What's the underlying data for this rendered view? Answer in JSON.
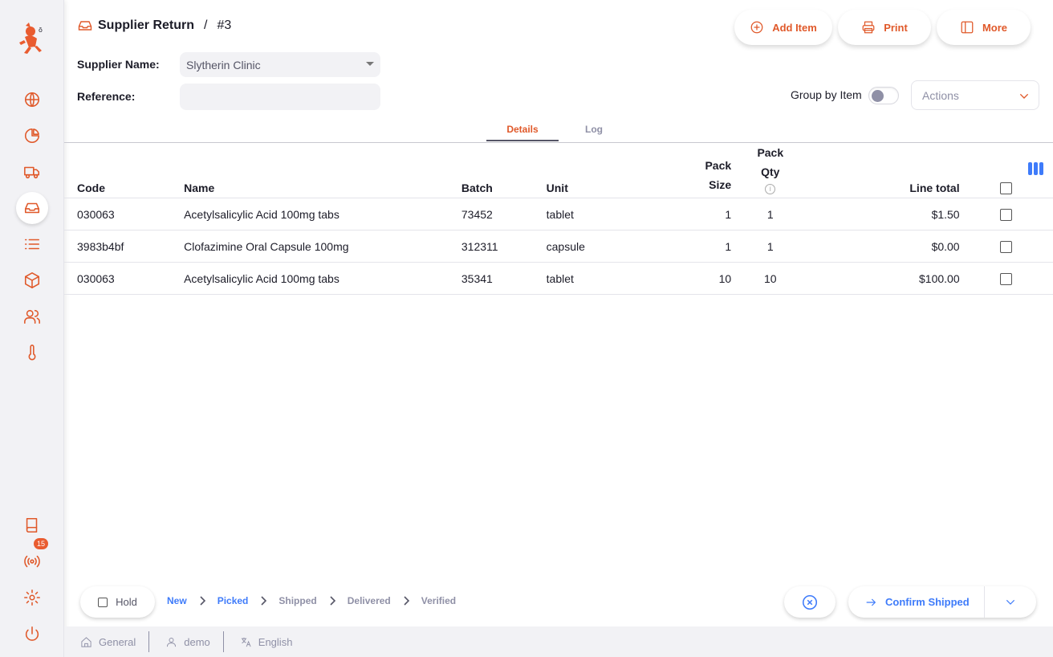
{
  "sidebar": {
    "notification_count": "15",
    "items": [
      {
        "icon": "globe-icon"
      },
      {
        "icon": "pie-chart-icon"
      },
      {
        "icon": "truck-icon"
      },
      {
        "icon": "inbox-icon",
        "active": true
      },
      {
        "icon": "list-icon"
      },
      {
        "icon": "box-icon"
      },
      {
        "icon": "users-icon"
      },
      {
        "icon": "thermometer-icon"
      }
    ],
    "bottom_items": [
      {
        "icon": "book-icon"
      },
      {
        "icon": "broadcast-icon"
      },
      {
        "icon": "gear-icon"
      },
      {
        "icon": "power-icon"
      }
    ]
  },
  "header": {
    "title": "Supplier Return",
    "separator": "/",
    "number": "#3",
    "buttons": {
      "add_item": "Add Item",
      "print": "Print",
      "more": "More"
    }
  },
  "form": {
    "supplier_label": "Supplier Name:",
    "supplier_value": "Slytherin Clinic",
    "reference_label": "Reference:",
    "reference_value": ""
  },
  "controls": {
    "group_by_label": "Group by Item",
    "group_by_enabled": false,
    "actions_placeholder": "Actions"
  },
  "tabs": [
    {
      "label": "Details",
      "active": true
    },
    {
      "label": "Log",
      "active": false
    }
  ],
  "table": {
    "headers": {
      "code": "Code",
      "name": "Name",
      "batch": "Batch",
      "unit": "Unit",
      "pack_size_1": "Pack",
      "pack_size_2": "Size",
      "pack_qty_1": "Pack",
      "pack_qty_2": "Qty",
      "line_total": "Line total",
      "info_glyph": "i"
    },
    "rows": [
      {
        "code": "030063",
        "name": "Acetylsalicylic Acid 100mg tabs",
        "batch": "73452",
        "unit": "tablet",
        "pack_size": "1",
        "pack_qty": "1",
        "line_total": "$1.50"
      },
      {
        "code": "3983b4bf",
        "name": "Clofazimine Oral Capsule 100mg",
        "batch": "312311",
        "unit": "capsule",
        "pack_size": "1",
        "pack_qty": "1",
        "line_total": "$0.00"
      },
      {
        "code": "030063",
        "name": "Acetylsalicylic Acid 100mg tabs",
        "batch": "35341",
        "unit": "tablet",
        "pack_size": "10",
        "pack_qty": "10",
        "line_total": "$100.00"
      }
    ]
  },
  "footer": {
    "hold_label": "Hold",
    "steps": [
      {
        "label": "New",
        "done": true
      },
      {
        "label": "Picked",
        "done": true
      },
      {
        "label": "Shipped",
        "done": false
      },
      {
        "label": "Delivered",
        "done": false
      },
      {
        "label": "Verified",
        "done": false
      }
    ],
    "confirm_label": "Confirm Shipped"
  },
  "statusbar": {
    "store": "General",
    "user": "demo",
    "language": "English"
  },
  "colors": {
    "accent": "#e0592a",
    "primary_blue": "#3e7bfa",
    "muted": "#8f90a6"
  }
}
